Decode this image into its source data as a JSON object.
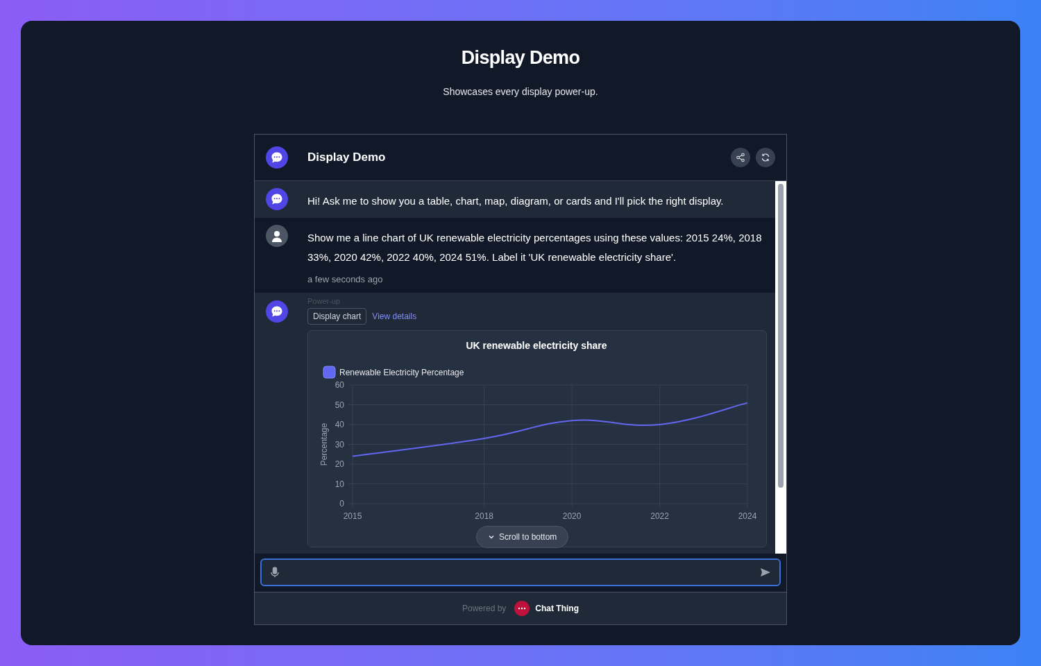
{
  "page": {
    "title": "Display Demo",
    "subtitle": "Showcases every display power-up."
  },
  "chat": {
    "title": "Display Demo",
    "messages": [
      {
        "kind": "bot",
        "text": "Hi! Ask me to show you a table, chart, map, diagram, or cards and I'll pick the right display."
      },
      {
        "kind": "user",
        "text": "Show me a line chart of UK renewable electricity percentages using these values: 2015 24%, 2018 33%, 2020 42%, 2022 40%, 2024 51%. Label it 'UK renewable electricity share'.",
        "time": "a few seconds ago"
      },
      {
        "kind": "powerup",
        "label": "Power-up",
        "tag": "Display chart",
        "link": "View details",
        "chart_data": {
          "type": "line",
          "title": "UK renewable electricity share",
          "ylabel": "Percentage",
          "x": [
            "2015",
            "2018",
            "2020",
            "2022",
            "2024"
          ],
          "series": [
            {
              "name": "Renewable Electricity Percentage",
              "color": "#6366f1",
              "values": [
                24,
                33,
                42,
                40,
                51
              ]
            }
          ],
          "grid": true,
          "ylim": [
            0,
            60
          ],
          "yticks": [
            0,
            10,
            20,
            30,
            40,
            50,
            60
          ]
        }
      }
    ],
    "scroll_button": "Scroll to bottom",
    "footer": {
      "prefix": "Powered by",
      "brand": "Chat Thing"
    }
  }
}
